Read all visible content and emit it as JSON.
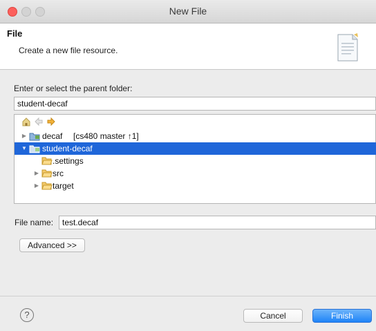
{
  "window": {
    "title": "New File"
  },
  "header": {
    "title": "File",
    "description": "Create a new file resource."
  },
  "parent_folder": {
    "label": "Enter or select the parent folder:",
    "value": "student-decaf"
  },
  "tree": {
    "nav_icons": [
      "home-icon",
      "back-icon",
      "forward-icon"
    ],
    "items": [
      {
        "label": "decaf",
        "suffix": "[cs480 master ↑1]",
        "expanded": false,
        "selected": false,
        "icon": "project-icon"
      },
      {
        "label": "student-decaf",
        "suffix": "",
        "expanded": true,
        "selected": true,
        "icon": "project-icon"
      },
      {
        "label": ".settings",
        "suffix": "",
        "expanded": false,
        "selected": false,
        "icon": "folder-icon"
      },
      {
        "label": "src",
        "suffix": "",
        "expanded": false,
        "selected": false,
        "icon": "folder-icon"
      },
      {
        "label": "target",
        "suffix": "",
        "expanded": false,
        "selected": false,
        "icon": "folder-icon"
      }
    ]
  },
  "file_name": {
    "label": "File name:",
    "value": "test.decaf"
  },
  "buttons": {
    "advanced": "Advanced >>",
    "cancel": "Cancel",
    "finish": "Finish",
    "help": "?"
  },
  "colors": {
    "selection": "#1f66d9",
    "accent": "#1f84f7",
    "folder": "#f4c96b"
  }
}
